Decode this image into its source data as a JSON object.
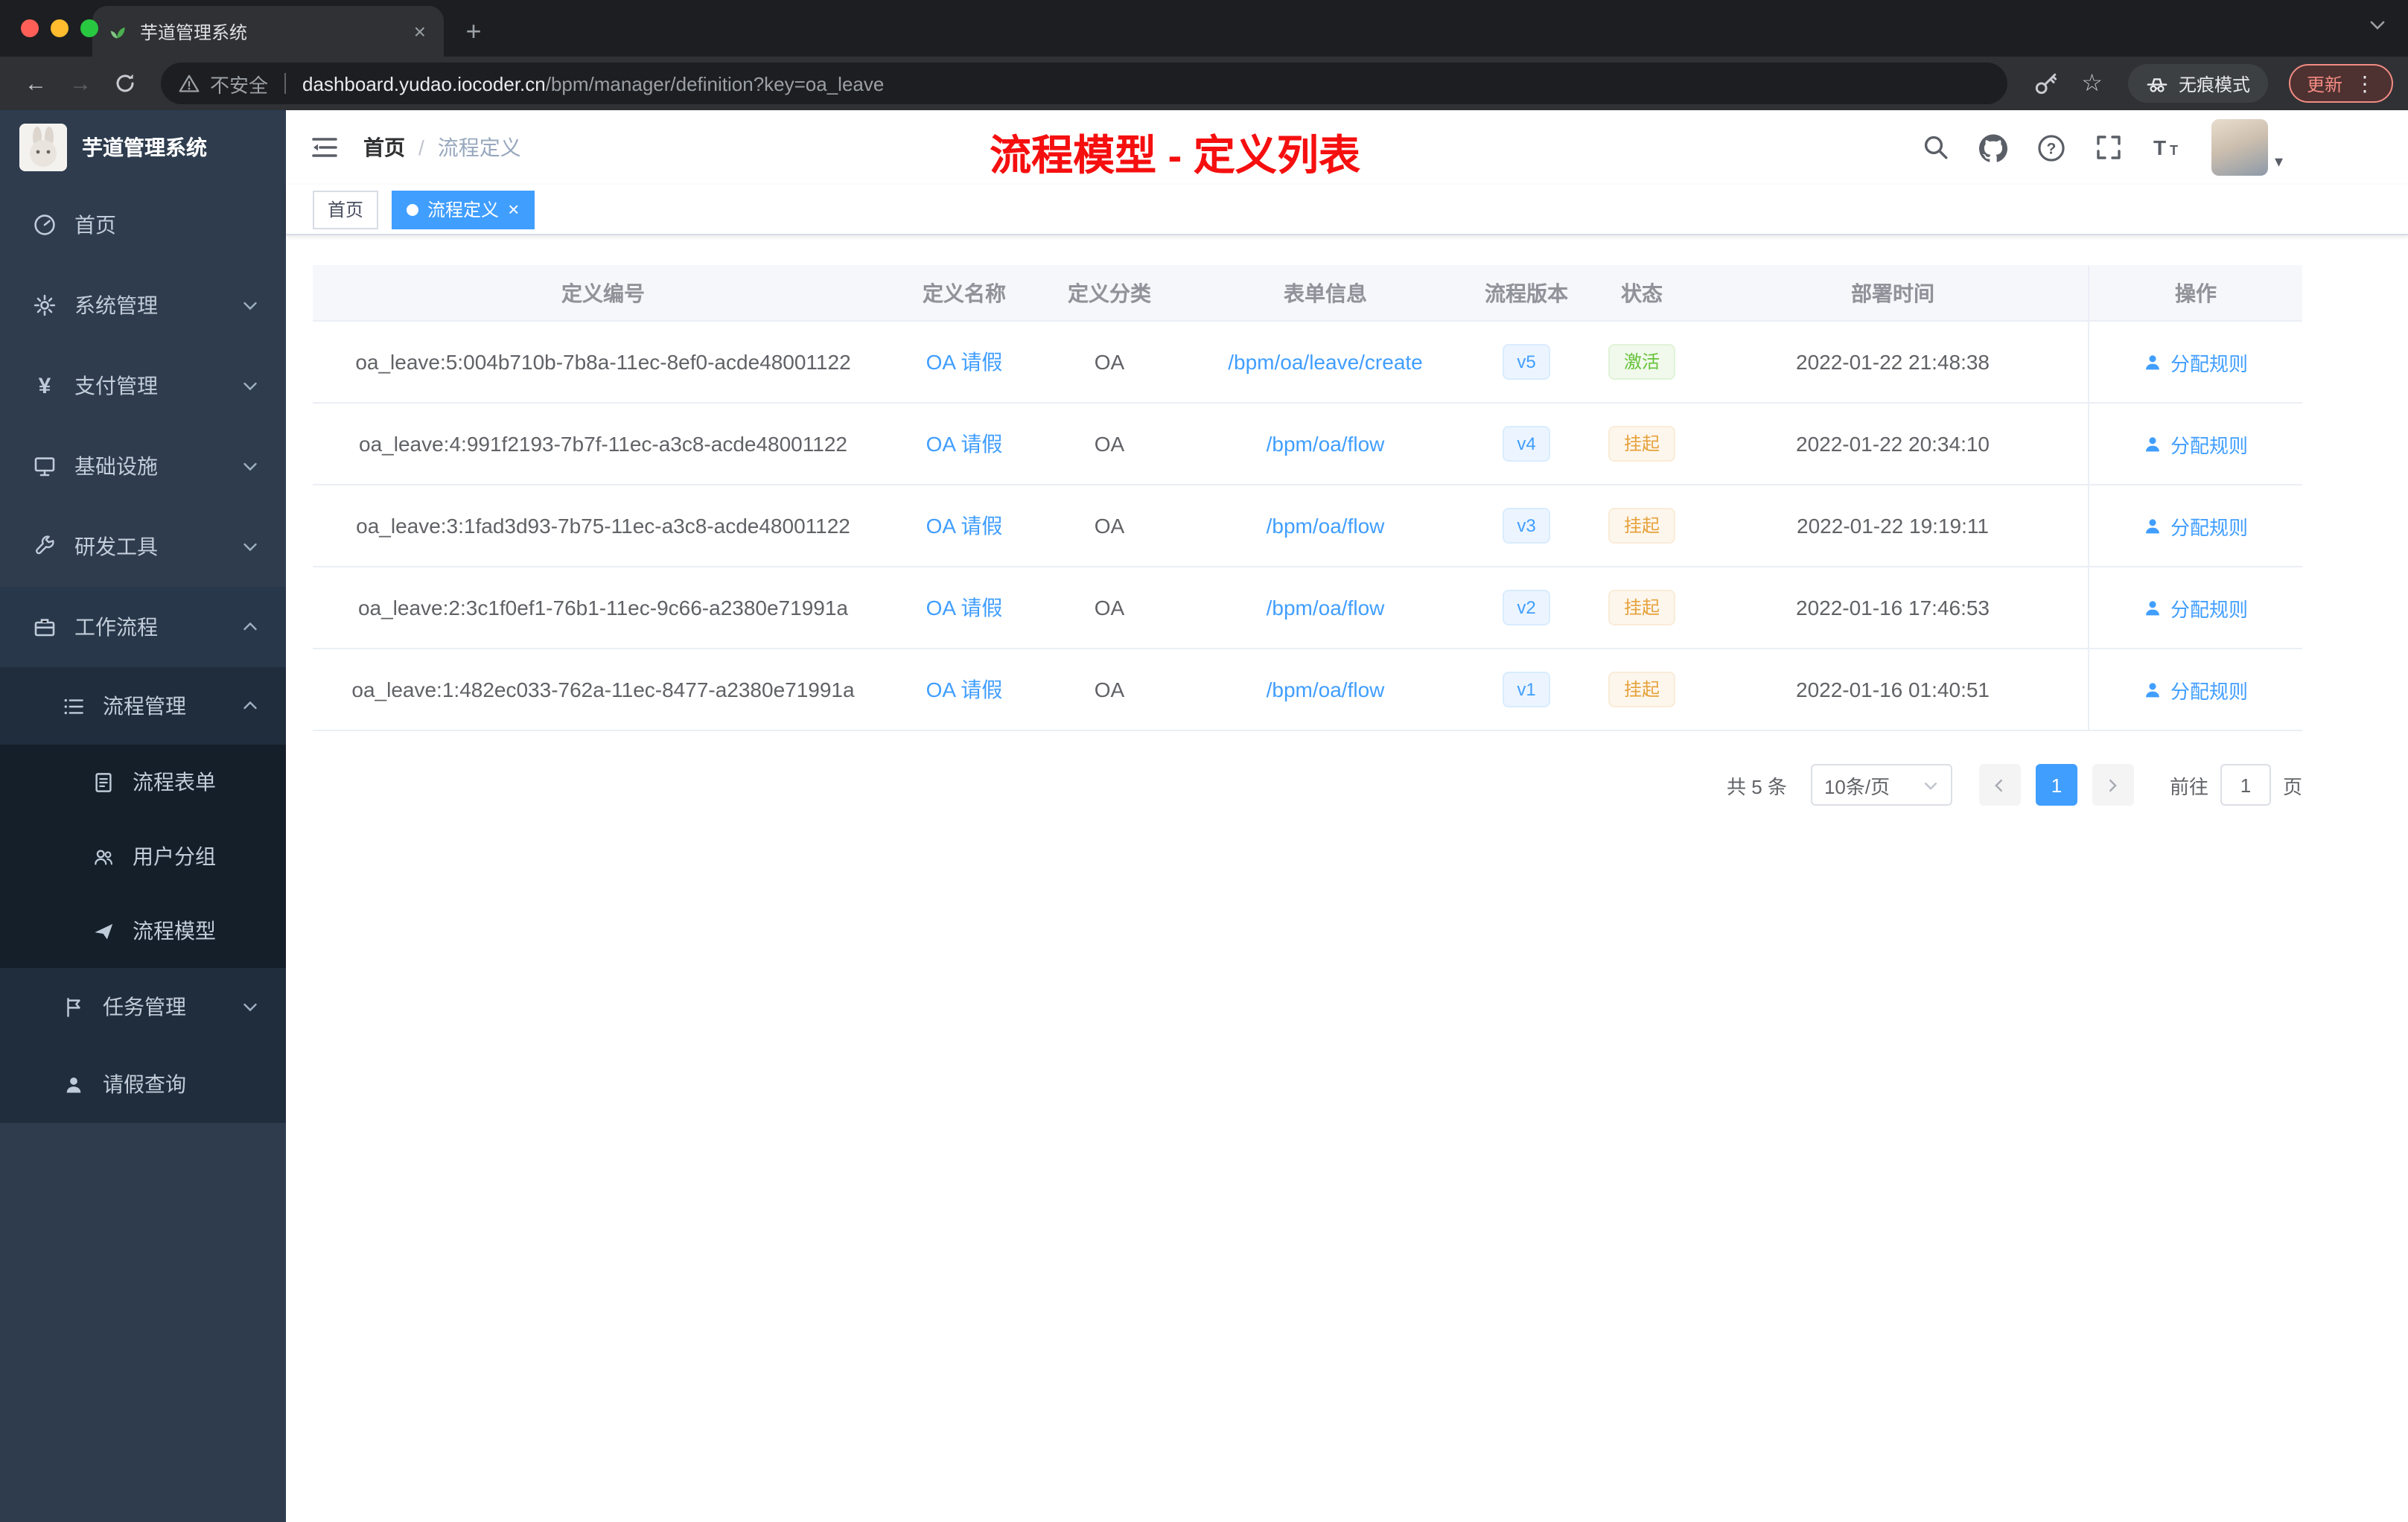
{
  "browser": {
    "tab_title": "芋道管理系统",
    "close_glyph": "×",
    "new_tab_glyph": "+",
    "back_glyph": "←",
    "forward_glyph": "→",
    "security_label": "不安全",
    "url_host": "dashboard.yudao.iocoder.cn",
    "url_path": "/bpm/manager/definition?key=oa_leave",
    "star_glyph": "☆",
    "incognito_label": "无痕模式",
    "update_label": "更新",
    "kebab_glyph": "⋮",
    "caret_glyph": "▾"
  },
  "sidebar": {
    "logo_title": "芋道管理系统",
    "yen_glyph": "¥",
    "items": [
      {
        "label": "首页"
      },
      {
        "label": "系统管理"
      },
      {
        "label": "支付管理"
      },
      {
        "label": "基础设施"
      },
      {
        "label": "研发工具"
      },
      {
        "label": "工作流程"
      },
      {
        "label": "流程管理"
      },
      {
        "label": "流程表单"
      },
      {
        "label": "用户分组"
      },
      {
        "label": "流程模型"
      },
      {
        "label": "任务管理"
      },
      {
        "label": "请假查询"
      }
    ]
  },
  "header": {
    "breadcrumb_home": "首页",
    "breadcrumb_sep": "/",
    "breadcrumb_current": "流程定义",
    "annotation": "流程模型 - 定义列表"
  },
  "tags": {
    "home": "首页",
    "active": "流程定义",
    "close_glyph": "×"
  },
  "table": {
    "columns": [
      "定义编号",
      "定义名称",
      "定义分类",
      "表单信息",
      "流程版本",
      "状态",
      "部署时间",
      "操作"
    ],
    "rows": [
      {
        "id": "oa_leave:5:004b710b-7b8a-11ec-8ef0-acde48001122",
        "name": "OA 请假",
        "category": "OA",
        "form": "/bpm/oa/leave/create",
        "version": "v5",
        "status": "激活",
        "status_type": "success",
        "time": "2022-01-22 21:48:38",
        "action": "分配规则"
      },
      {
        "id": "oa_leave:4:991f2193-7b7f-11ec-a3c8-acde48001122",
        "name": "OA 请假",
        "category": "OA",
        "form": "/bpm/oa/flow",
        "version": "v4",
        "status": "挂起",
        "status_type": "warning",
        "time": "2022-01-22 20:34:10",
        "action": "分配规则"
      },
      {
        "id": "oa_leave:3:1fad3d93-7b75-11ec-a3c8-acde48001122",
        "name": "OA 请假",
        "category": "OA",
        "form": "/bpm/oa/flow",
        "version": "v3",
        "status": "挂起",
        "status_type": "warning",
        "time": "2022-01-22 19:19:11",
        "action": "分配规则"
      },
      {
        "id": "oa_leave:2:3c1f0ef1-76b1-11ec-9c66-a2380e71991a",
        "name": "OA 请假",
        "category": "OA",
        "form": "/bpm/oa/flow",
        "version": "v2",
        "status": "挂起",
        "status_type": "warning",
        "time": "2022-01-16 17:46:53",
        "action": "分配规则"
      },
      {
        "id": "oa_leave:1:482ec033-762a-11ec-8477-a2380e71991a",
        "name": "OA 请假",
        "category": "OA",
        "form": "/bpm/oa/flow",
        "version": "v1",
        "status": "挂起",
        "status_type": "warning",
        "time": "2022-01-16 01:40:51",
        "action": "分配规则"
      }
    ]
  },
  "pagination": {
    "total": "共 5 条",
    "page_size": "10条/页",
    "page": "1",
    "goto_label": "前往",
    "goto_value": "1",
    "unit_label": "页"
  },
  "colors": {
    "accent": "#409eff",
    "success": "#67c23a",
    "warning": "#e6a23c",
    "annotation_red": "#f50f0f",
    "sidebar_bg": "#2e3c4e",
    "submenu_bg": "#1f2d3d"
  }
}
